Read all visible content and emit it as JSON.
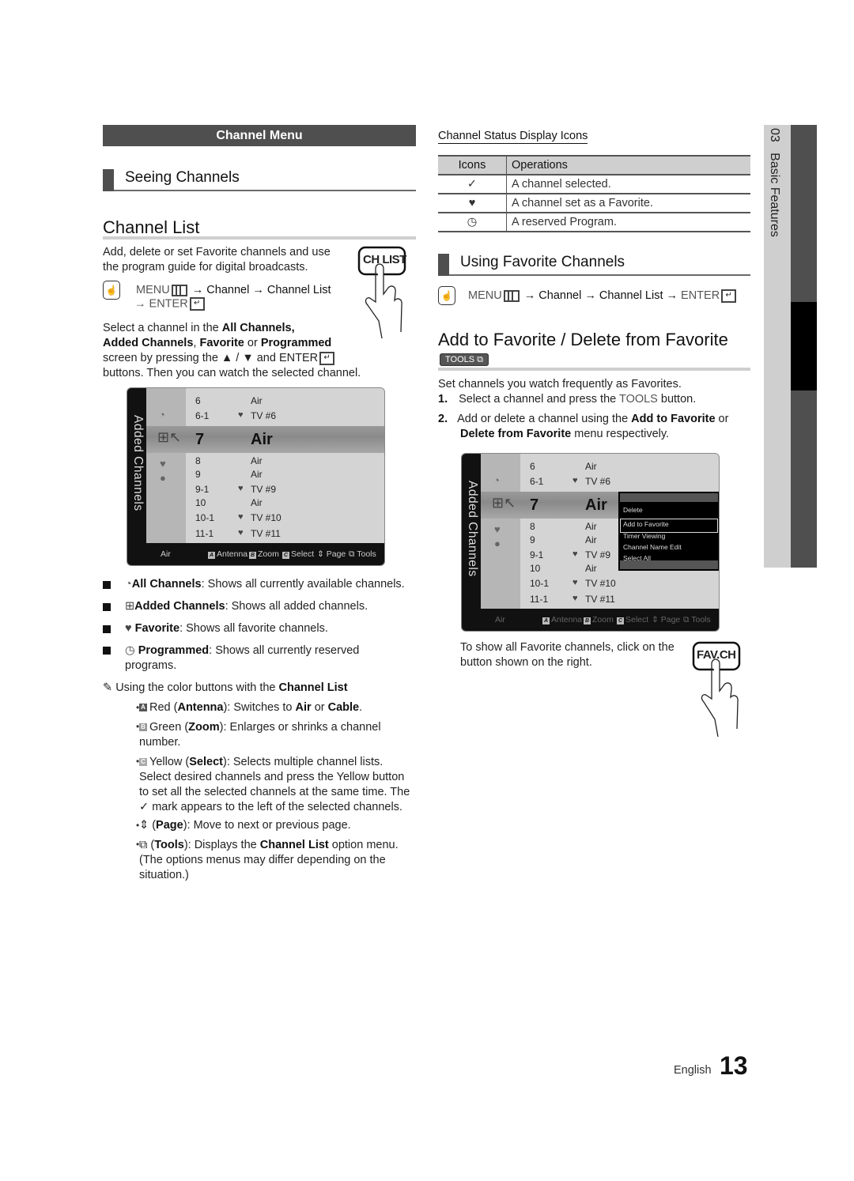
{
  "section_title": "Channel Menu",
  "seeing_channels": "Seeing Channels",
  "channel_list": {
    "title": "Channel List",
    "intro_1": "Add, delete or set Favorite channels and use",
    "intro_2": "the program guide for digital broadcasts.",
    "remote_button": "CH LIST",
    "menu_path_1": "MENU",
    "menu_path_2": "→ Channel → Channel List",
    "menu_path_3": "→ ENTER",
    "select_text": {
      "l1a": "Select a channel in the ",
      "l1b": "All Channels,",
      "l2a": "Added Channels",
      "l2b": ", ",
      "l2c": "Favorite",
      "l2d": " or ",
      "l2e": "Programmed",
      "l3": "screen by pressing the ▲ / ▼ and ENTER",
      "l4": "buttons. Then you can watch the selected channel."
    }
  },
  "tv_screen": {
    "side_label": "Added Channels",
    "rows": [
      {
        "num": "6",
        "fav": false,
        "name": "Air"
      },
      {
        "num": "6-1",
        "fav": true,
        "name": "TV #6"
      },
      {
        "num": "7",
        "fav": false,
        "name": "Air",
        "selected": true
      },
      {
        "num": "8",
        "fav": false,
        "name": "Air"
      },
      {
        "num": "9",
        "fav": false,
        "name": "Air"
      },
      {
        "num": "9-1",
        "fav": true,
        "name": "TV #9"
      },
      {
        "num": "10",
        "fav": false,
        "name": "Air"
      },
      {
        "num": "10-1",
        "fav": true,
        "name": "TV #10"
      },
      {
        "num": "11-1",
        "fav": true,
        "name": "TV #11"
      }
    ],
    "footer": {
      "source": "Air",
      "a_key": "A",
      "antenna": "Antenna",
      "b_key": "B",
      "zoom": "Zoom",
      "c_key": "C",
      "select": "Select",
      "page": "Page",
      "tools": "Tools"
    }
  },
  "list_types": [
    {
      "icon": "all-channels-icon",
      "label": "All Channels",
      "desc": ": Shows all currently available channels."
    },
    {
      "icon": "added-channels-icon",
      "label": "Added Channels",
      "desc": ": Shows all added channels."
    },
    {
      "icon": "favorite-icon",
      "label": "Favorite",
      "desc": ": Shows all favorite channels."
    },
    {
      "icon": "programmed-icon",
      "label": "Programmed",
      "desc": ": Shows all currently reserved",
      "desc2": "programs."
    }
  ],
  "note": {
    "text": "Using the color buttons with the ",
    "bold": "Channel List"
  },
  "color_buttons": {
    "red": {
      "key": "A",
      "a": "Red (",
      "b": "Antenna",
      "c": "): Switches to ",
      "d": "Air",
      "e": " or ",
      "f": "Cable",
      "g": "."
    },
    "green": {
      "key": "B",
      "a": "Green (",
      "b": "Zoom",
      "c": "): Enlarges or shrinks a channel",
      "l2": "number."
    },
    "yellow": {
      "key": "C",
      "a": "Yellow (",
      "b": "Select",
      "c": "): Selects multiple channel lists.",
      "l2": "Select desired channels and press the Yellow button",
      "l3": "to set all the selected channels at the same time. The",
      "l4": "mark appears to the left of the selected channels."
    },
    "page": {
      "a": "(",
      "b": "Page",
      "c": "): Move to next or previous page."
    },
    "tools": {
      "a": "(",
      "b": "Tools",
      "c": "): Displays the ",
      "d": "Channel List",
      "e": " option menu.",
      "l2": "(The options menus may differ depending on the",
      "l3": "situation.)"
    }
  },
  "status_icons": {
    "title": "Channel Status Display Icons",
    "headers": [
      "Icons",
      "Operations"
    ],
    "rows": [
      {
        "icon": "checkmark-icon",
        "glyph": "✓",
        "op": "A channel selected."
      },
      {
        "icon": "heart-icon",
        "glyph": "♥",
        "op": "A channel set as a Favorite."
      },
      {
        "icon": "clock-icon",
        "glyph": "◷",
        "op": "A reserved Program."
      }
    ]
  },
  "using_favorites": {
    "title": "Using Favorite Channels",
    "menu_a": "MENU",
    "menu_b": "→ Channel → Channel List → ",
    "menu_c": "ENTER"
  },
  "add_favorite": {
    "title": "Add to Favorite / Delete from Favorite",
    "tools_badge": "TOOLS",
    "intro": "Set channels you watch frequently as Favorites.",
    "step1_num": "1.",
    "step1_a": "Select a channel and press the ",
    "step1_b": "TOOLS",
    "step1_c": " button.",
    "step2_num": "2.",
    "step2_a": "Add or delete a channel using the ",
    "step2_b": "Add to Favorite",
    "step2_c": " or",
    "step2_d": "Delete from Favorite",
    "step2_e": " menu respectively."
  },
  "tools_menu": {
    "items": [
      "Delete",
      "Add to Favorite",
      "Timer Viewing",
      "Channel Name Edit",
      "Select All"
    ],
    "selected": "Add to Favorite"
  },
  "fav_note": {
    "l1": "To show all Favorite channels, click on the",
    "l2": "button shown on the right.",
    "remote_button": "FAV.CH"
  },
  "side_tab": {
    "chapter": "03",
    "title": "Basic Features"
  },
  "footer": {
    "language": "English",
    "page": "13"
  }
}
